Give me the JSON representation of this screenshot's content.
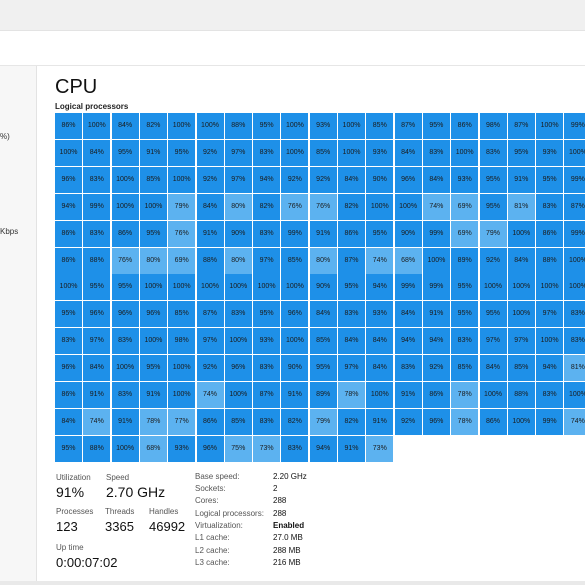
{
  "left_panel": {
    "frag_1": "%)",
    "frag_2": "Kbps"
  },
  "page": {
    "title": "CPU",
    "grid_label": "Logical processors"
  },
  "colors": {
    "cell": "#1e90e8",
    "cell_light": "#5cb2f0"
  },
  "processors": [
    "86%",
    "100%",
    "84%",
    "82%",
    "100%",
    "100%",
    "88%",
    "95%",
    "100%",
    "93%",
    "100%",
    "85%",
    "87%",
    "95%",
    "86%",
    "98%",
    "87%",
    "100%",
    "99%",
    "100%",
    "84%",
    "95%",
    "91%",
    "95%",
    "92%",
    "97%",
    "83%",
    "100%",
    "85%",
    "100%",
    "93%",
    "84%",
    "83%",
    "100%",
    "83%",
    "95%",
    "93%",
    "100%",
    "96%",
    "83%",
    "100%",
    "85%",
    "100%",
    "92%",
    "97%",
    "94%",
    "92%",
    "92%",
    "84%",
    "90%",
    "96%",
    "84%",
    "93%",
    "95%",
    "91%",
    "95%",
    "99%",
    "94%",
    "99%",
    "100%",
    "100%",
    "79%",
    "84%",
    "80%",
    "82%",
    "76%",
    "76%",
    "82%",
    "100%",
    "100%",
    "74%",
    "69%",
    "95%",
    "81%",
    "83%",
    "87%",
    "86%",
    "83%",
    "86%",
    "95%",
    "76%",
    "91%",
    "90%",
    "83%",
    "99%",
    "91%",
    "86%",
    "95%",
    "90%",
    "99%",
    "69%",
    "79%",
    "100%",
    "86%",
    "99%",
    "86%",
    "88%",
    "76%",
    "80%",
    "69%",
    "88%",
    "80%",
    "97%",
    "85%",
    "80%",
    "87%",
    "74%",
    "68%",
    "100%",
    "89%",
    "92%",
    "84%",
    "88%",
    "100%",
    "100%",
    "95%",
    "95%",
    "100%",
    "100%",
    "100%",
    "100%",
    "100%",
    "100%",
    "90%",
    "95%",
    "94%",
    "99%",
    "99%",
    "95%",
    "100%",
    "100%",
    "100%",
    "100%",
    "95%",
    "96%",
    "96%",
    "96%",
    "85%",
    "87%",
    "83%",
    "95%",
    "96%",
    "84%",
    "83%",
    "93%",
    "84%",
    "91%",
    "95%",
    "95%",
    "100%",
    "97%",
    "83%",
    "83%",
    "97%",
    "83%",
    "100%",
    "98%",
    "97%",
    "100%",
    "93%",
    "100%",
    "85%",
    "84%",
    "84%",
    "94%",
    "94%",
    "83%",
    "97%",
    "97%",
    "100%",
    "83%",
    "96%",
    "84%",
    "100%",
    "95%",
    "100%",
    "92%",
    "96%",
    "83%",
    "90%",
    "95%",
    "97%",
    "84%",
    "83%",
    "92%",
    "85%",
    "84%",
    "85%",
    "94%",
    "81%",
    "86%",
    "91%",
    "83%",
    "91%",
    "100%",
    "74%",
    "100%",
    "87%",
    "91%",
    "89%",
    "78%",
    "100%",
    "91%",
    "86%",
    "78%",
    "100%",
    "88%",
    "83%",
    "100%",
    "84%",
    "74%",
    "91%",
    "78%",
    "77%",
    "86%",
    "85%",
    "83%",
    "82%",
    "79%",
    "82%",
    "91%",
    "92%",
    "96%",
    "78%",
    "86%",
    "100%",
    "99%",
    "74%",
    "95%",
    "88%",
    "100%",
    "68%",
    "93%",
    "96%",
    "75%",
    "73%",
    "83%",
    "94%",
    "91%",
    "73%"
  ],
  "stats": {
    "utilization_label": "Utilization",
    "utilization": "91%",
    "speed_label": "Speed",
    "speed": "2.70 GHz",
    "processes_label": "Processes",
    "processes": "123",
    "threads_label": "Threads",
    "threads": "3365",
    "handles_label": "Handles",
    "handles": "46992",
    "uptime_label": "Up time",
    "uptime": "0:00:07:02"
  },
  "specs": [
    {
      "label": "Base speed:",
      "value": "2.20 GHz"
    },
    {
      "label": "Sockets:",
      "value": "2"
    },
    {
      "label": "Cores:",
      "value": "288"
    },
    {
      "label": "Logical processors:",
      "value": "288"
    },
    {
      "label": "Virtualization:",
      "value": "Enabled"
    },
    {
      "label": "L1 cache:",
      "value": "27.0 MB"
    },
    {
      "label": "L2 cache:",
      "value": "288 MB"
    },
    {
      "label": "L3 cache:",
      "value": "216 MB"
    }
  ]
}
